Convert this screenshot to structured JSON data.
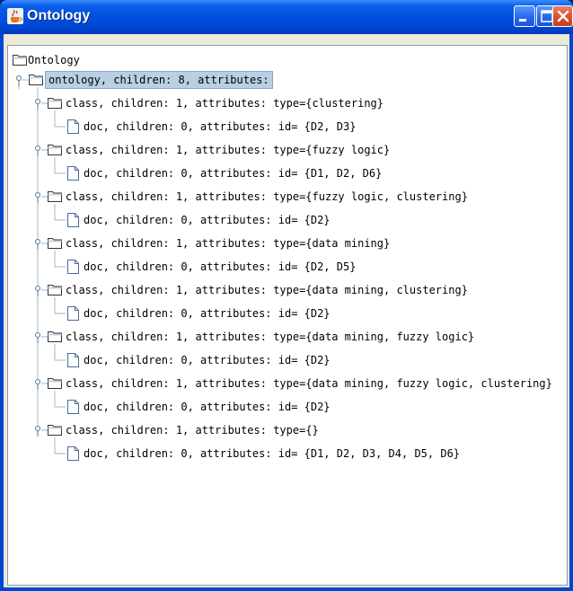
{
  "window": {
    "title": "Ontology"
  },
  "tree": {
    "root_label": "Ontology",
    "ontology_node": "ontology, children: 8, attributes:",
    "classes": [
      {
        "label": "class, children: 1, attributes: type={clustering}",
        "doc": "doc, children: 0, attributes: id=  {D2, D3}"
      },
      {
        "label": "class, children: 1, attributes: type={fuzzy logic}",
        "doc": "doc, children: 0, attributes: id=  {D1, D2, D6}"
      },
      {
        "label": "class, children: 1, attributes: type={fuzzy logic, clustering}",
        "doc": "doc, children: 0, attributes: id=  {D2}"
      },
      {
        "label": "class, children: 1, attributes: type={data mining}",
        "doc": "doc, children: 0, attributes: id=  {D2, D5}"
      },
      {
        "label": "class, children: 1, attributes: type={data mining, clustering}",
        "doc": "doc, children: 0, attributes: id=  {D2}"
      },
      {
        "label": "class, children: 1, attributes: type={data mining, fuzzy logic}",
        "doc": "doc, children: 0, attributes: id=  {D2}"
      },
      {
        "label": "class, children: 1, attributes: type={data mining, fuzzy logic, clustering}",
        "doc": "doc, children: 0, attributes: id=  {D2}"
      },
      {
        "label": "class, children: 1, attributes: type={}",
        "doc": "doc, children: 0, attributes: id=  {D1, D2, D3, D4, D5, D6}"
      }
    ]
  },
  "colors": {
    "titlebar": "#0050e0",
    "selection": "#b8cfe5",
    "close_button": "#d9532f",
    "tree_line": "#a0b4c8"
  },
  "icons": {
    "app": "java-coffee-icon",
    "folder": "folder-icon",
    "document": "document-icon",
    "expanded_handle": "expand-handle-icon"
  }
}
